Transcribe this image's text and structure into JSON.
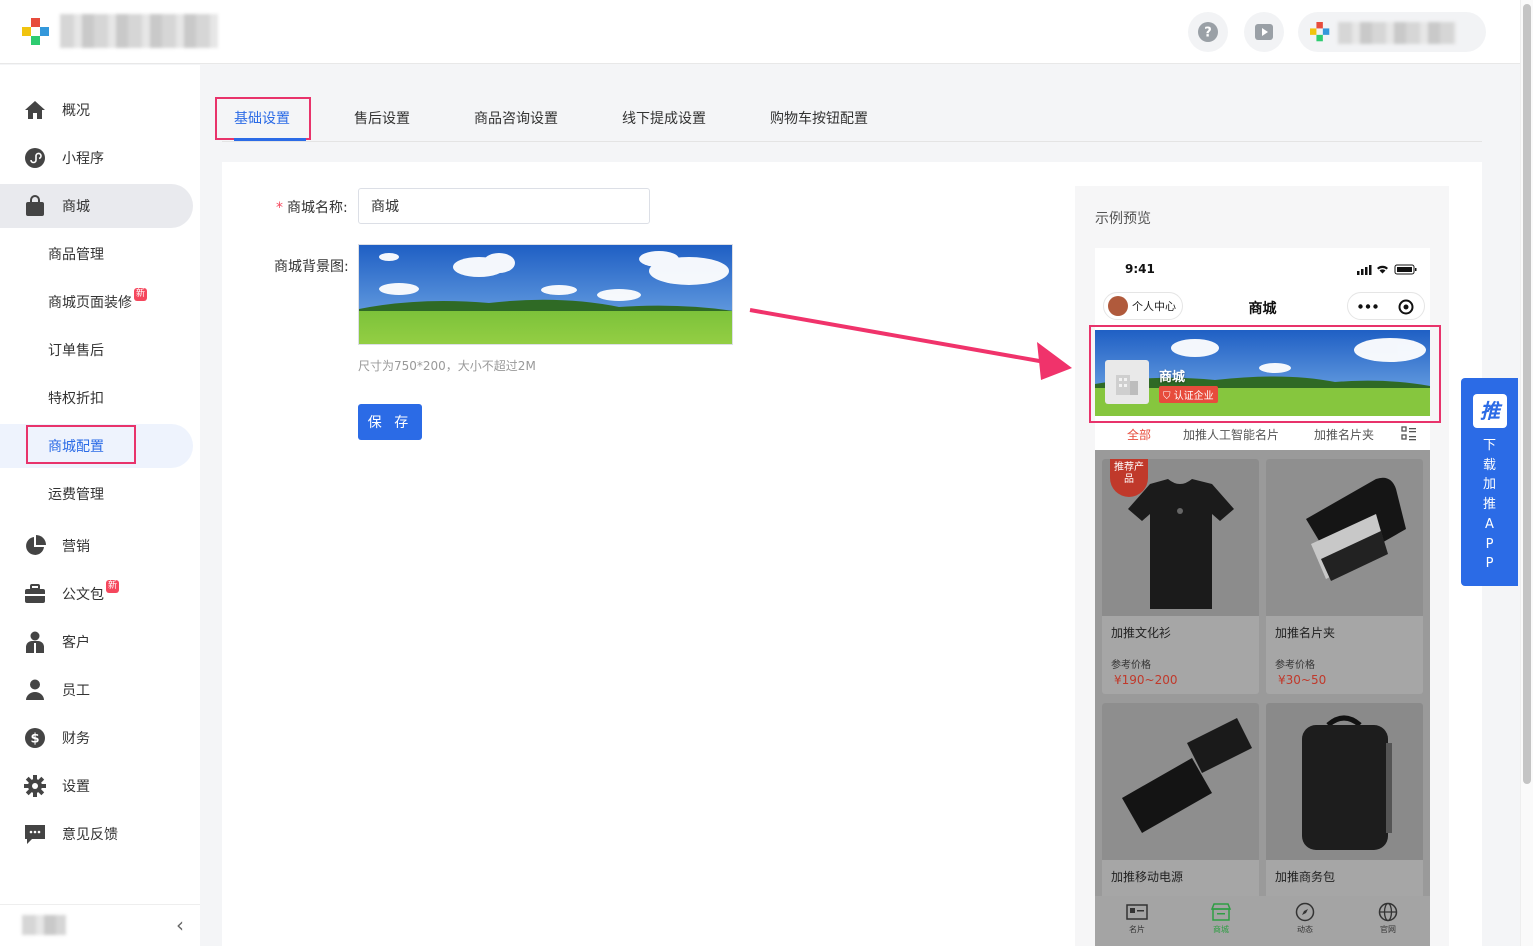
{
  "sidebar": {
    "items": [
      {
        "label": "概况",
        "icon": "home-icon"
      },
      {
        "label": "小程序",
        "icon": "mini-program-icon"
      },
      {
        "label": "商城",
        "icon": "shopping-bag-icon"
      },
      {
        "label": "营销",
        "icon": "pie-chart-icon"
      },
      {
        "label": "公文包",
        "icon": "briefcase-icon",
        "badge": "新"
      },
      {
        "label": "客户",
        "icon": "customer-icon"
      },
      {
        "label": "员工",
        "icon": "user-icon"
      },
      {
        "label": "财务",
        "icon": "dollar-icon"
      },
      {
        "label": "设置",
        "icon": "gear-icon"
      },
      {
        "label": "意见反馈",
        "icon": "feedback-icon"
      }
    ],
    "mall_sub": [
      {
        "label": "商品管理"
      },
      {
        "label": "商城页面装修",
        "badge": "新"
      },
      {
        "label": "订单售后"
      },
      {
        "label": "特权折扣"
      },
      {
        "label": "商城配置"
      },
      {
        "label": "运费管理"
      }
    ],
    "collapse_icon": "‹"
  },
  "tabs": [
    {
      "label": "基础设置"
    },
    {
      "label": "售后设置"
    },
    {
      "label": "商品咨询设置"
    },
    {
      "label": "线下提成设置"
    },
    {
      "label": "购物车按钮配置"
    }
  ],
  "form": {
    "required_mark": "*",
    "name_label": "商城名称:",
    "name_value": "商城",
    "bg_label": "商城背景图:",
    "bg_hint": "尺寸为750*200，大小不超过2M",
    "save_label": "保 存"
  },
  "preview": {
    "title": "示例预览",
    "status_time": "9:41",
    "personal_center": "个人中心",
    "page_title": "商城",
    "shop_name": "商城",
    "verified": "认证企业",
    "categories": [
      "全部",
      "加推人工智能名片",
      "加推名片夹"
    ],
    "products": [
      {
        "name": "加推文化衫",
        "price_label": "参考价格",
        "price": "¥190~200",
        "tag": "推荐产品"
      },
      {
        "name": "加推名片夹",
        "price_label": "参考价格",
        "price": "¥30~50"
      },
      {
        "name": "加推移动电源"
      },
      {
        "name": "加推商务包"
      }
    ],
    "tabbar": [
      {
        "label": "名片",
        "icon": "card-icon"
      },
      {
        "label": "商城",
        "icon": "store-icon"
      },
      {
        "label": "动态",
        "icon": "compass-icon"
      },
      {
        "label": "官网",
        "icon": "globe-icon"
      }
    ]
  },
  "float_app": {
    "logo": "推",
    "text": [
      "下",
      "载",
      "加",
      "推",
      "A",
      "P",
      "P"
    ]
  },
  "colors": {
    "primary": "#2b6be6",
    "highlight": "#e8336b",
    "price": "#c0392b"
  }
}
